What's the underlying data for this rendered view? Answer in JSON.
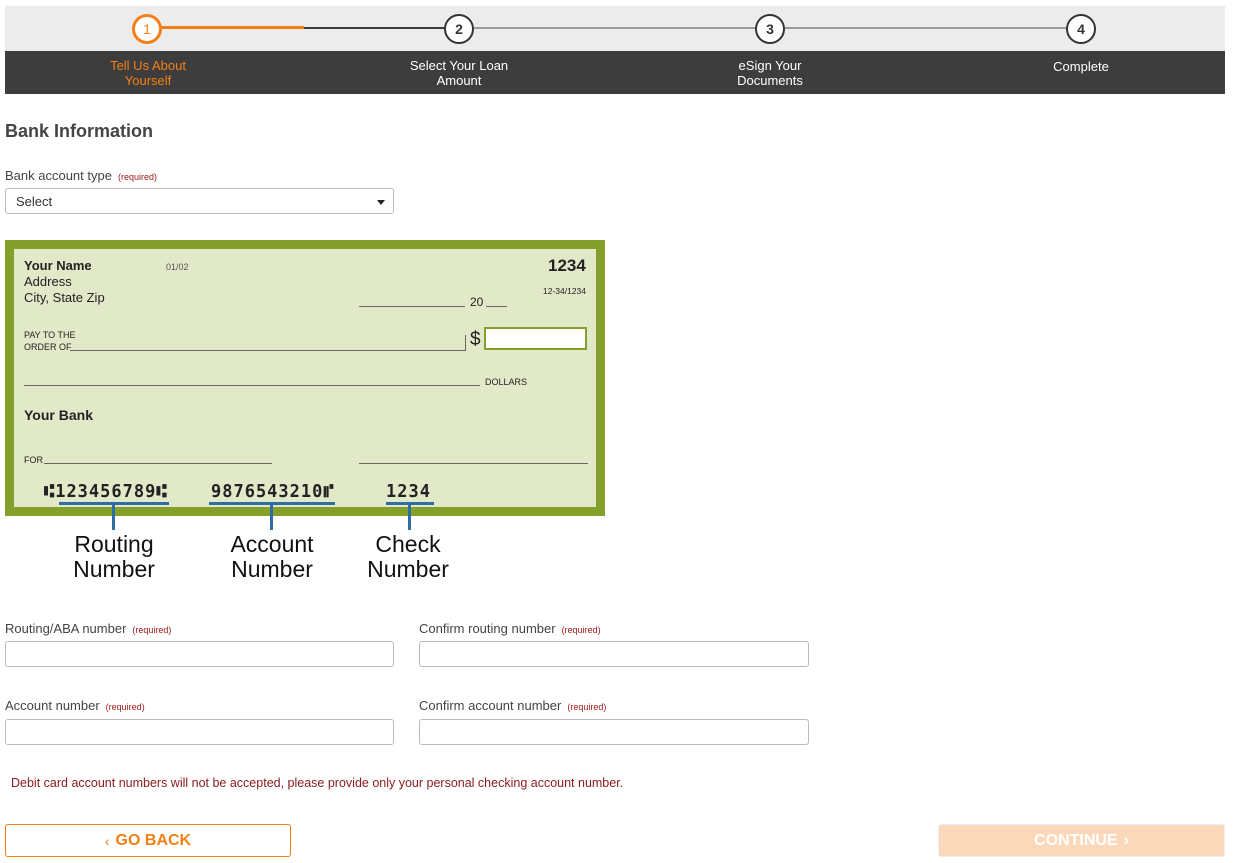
{
  "stepper": {
    "steps": [
      {
        "number": "1",
        "label_line1": "Tell Us About",
        "label_line2": "Yourself",
        "state": "active"
      },
      {
        "number": "2",
        "label_line1": "Select Your Loan",
        "label_line2": "Amount",
        "state": "upcoming"
      },
      {
        "number": "3",
        "label_line1": "eSign Your",
        "label_line2": "Documents",
        "state": "upcoming"
      },
      {
        "number": "4",
        "label_line1": "Complete",
        "label_line2": "",
        "state": "upcoming"
      }
    ],
    "accent_color": "#f47f16"
  },
  "section": {
    "title": "Bank Information"
  },
  "required_tag": "(required)",
  "account_type": {
    "label": "Bank account type",
    "selected": "Select"
  },
  "check_illustration": {
    "name": "Your Name",
    "address": "Address",
    "city_state_zip": "City, State Zip",
    "date_code": "01/02",
    "check_number_top": "1234",
    "fraction_code": "12-34/1234",
    "date_label": "20",
    "pay_to_line1": "PAY TO THE",
    "pay_to_line2": "ORDER OF",
    "dollar_sign": "$",
    "dollars_label": "DOLLARS",
    "bank_name": "Your Bank",
    "for_label": "FOR",
    "micr_routing": "⑆123456789⑆",
    "micr_routing_text": "123456789",
    "micr_account_text": "9876543210",
    "micr_check_text": "1234",
    "captions": [
      {
        "line1": "Routing",
        "line2": "Number"
      },
      {
        "line1": "Account",
        "line2": "Number"
      },
      {
        "line1": "Check",
        "line2": "Number"
      }
    ]
  },
  "fields": {
    "routing": {
      "label": "Routing/ABA number",
      "value": ""
    },
    "confirm_routing": {
      "label": "Confirm routing number",
      "value": ""
    },
    "account": {
      "label": "Account number",
      "value": ""
    },
    "confirm_account": {
      "label": "Confirm account number",
      "value": ""
    }
  },
  "notice": "Debit card account numbers will not be accepted, please provide only your personal checking account number.",
  "buttons": {
    "back": {
      "label": "GO BACK",
      "icon": "‹"
    },
    "continue": {
      "label": "CONTINUE",
      "icon": "›",
      "disabled": true
    }
  }
}
